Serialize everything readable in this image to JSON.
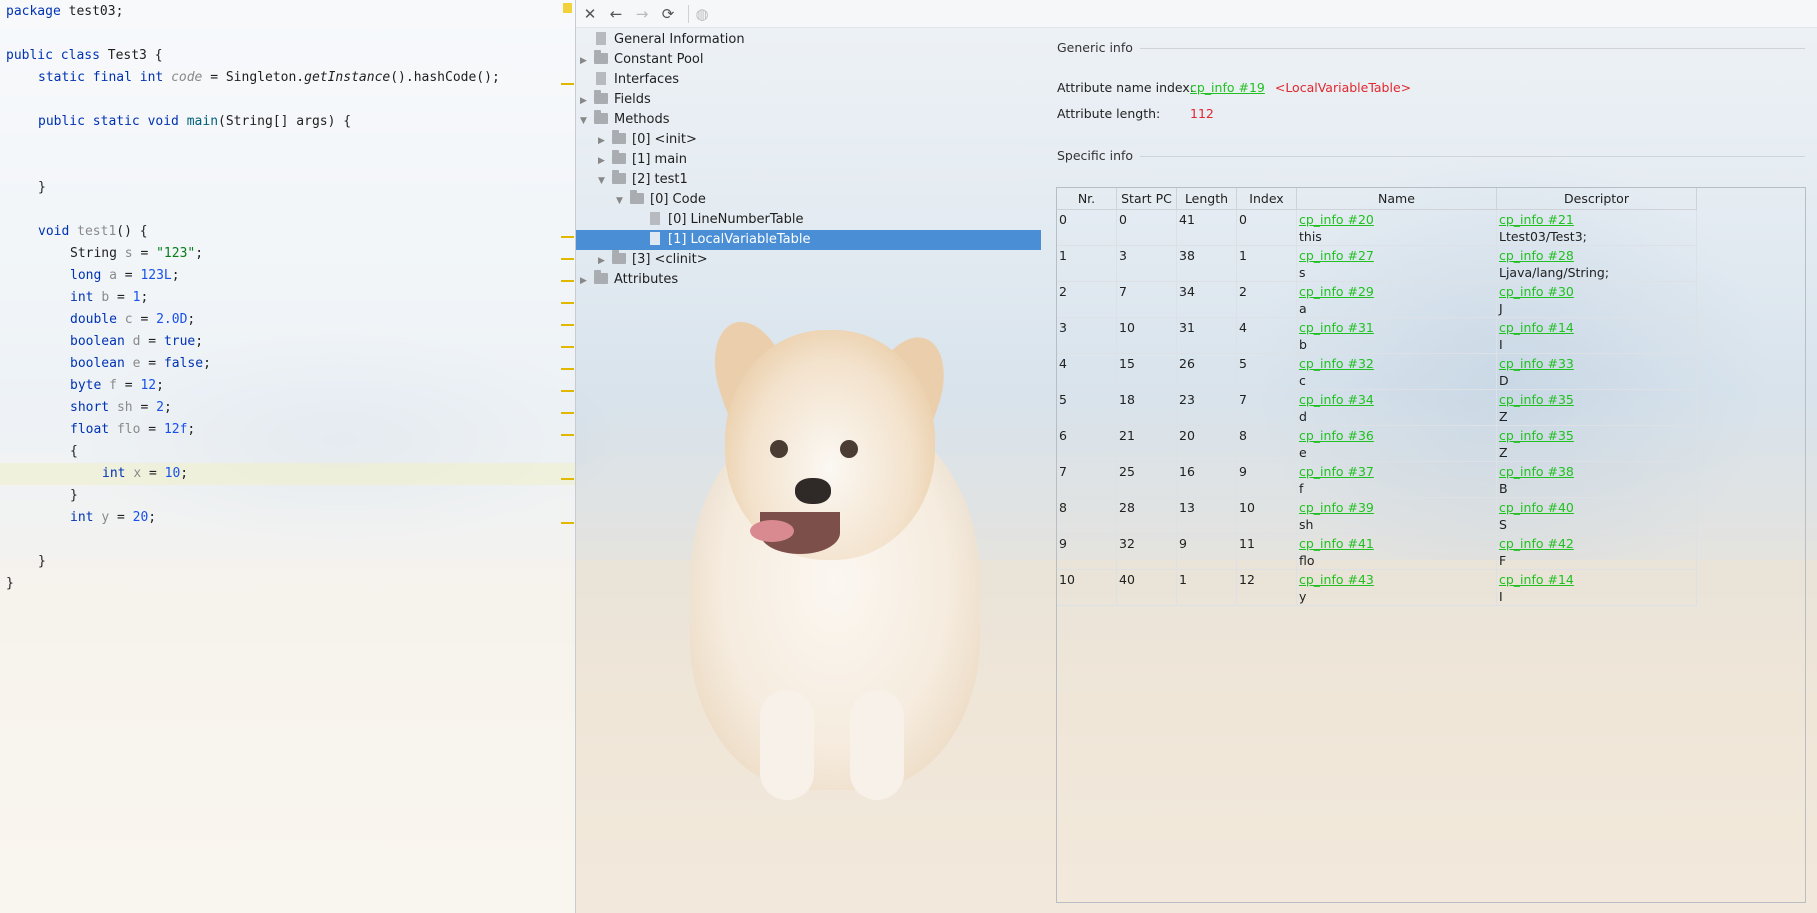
{
  "editor": {
    "lines": [
      {
        "n": 0,
        "text": "package test03;"
      },
      {
        "n": 1,
        "text": "public class Test3 {"
      },
      {
        "n": 2,
        "text": "static final int code = Singleton.getInstance().hashCode();"
      },
      {
        "n": 3,
        "text": "public static void main(String[] args) {"
      },
      {
        "n": 4,
        "text": "}"
      },
      {
        "n": 5,
        "text": "void test1() {"
      },
      {
        "n": 6,
        "text": "String s = \"123\";"
      },
      {
        "n": 7,
        "text": "long a = 123L;"
      },
      {
        "n": 8,
        "text": "int b = 1;"
      },
      {
        "n": 9,
        "text": "double c = 2.0D;"
      },
      {
        "n": 10,
        "text": "boolean d = true;"
      },
      {
        "n": 11,
        "text": "boolean e = false;"
      },
      {
        "n": 12,
        "text": "byte f = 12;"
      },
      {
        "n": 13,
        "text": "short sh = 2;"
      },
      {
        "n": 14,
        "text": "float flo = 12f;"
      },
      {
        "n": 15,
        "text": "{"
      },
      {
        "n": 16,
        "text": "int x = 10;"
      },
      {
        "n": 17,
        "text": "}"
      },
      {
        "n": 18,
        "text": "int y = 20;"
      },
      {
        "n": 19,
        "text": "}"
      },
      {
        "n": 20,
        "text": "}"
      }
    ]
  },
  "toolbar": {
    "close_icon": "close-icon",
    "back_icon": "arrow-left-icon",
    "forward_icon": "arrow-right-icon",
    "refresh_icon": "refresh-icon",
    "web_icon": "globe-icon"
  },
  "tree": {
    "general_information": "General Information",
    "constant_pool": "Constant Pool",
    "interfaces": "Interfaces",
    "fields": "Fields",
    "methods": "Methods",
    "method_0": "[0] <init>",
    "method_1": "[1] main",
    "method_2": "[2] test1",
    "code": "[0] Code",
    "line_number_table": "[0] LineNumberTable",
    "local_variable_table": "[1] LocalVariableTable",
    "method_3": "[3] <clinit>",
    "attributes": "Attributes"
  },
  "details": {
    "generic_info_title": "Generic info",
    "attr_name_index_label": "Attribute name index:",
    "attr_name_index_link": "cp_info #19",
    "attr_name_index_value": "<LocalVariableTable>",
    "attr_length_label": "Attribute length:",
    "attr_length_value": "112",
    "specific_info_title": "Specific info",
    "columns": [
      "Nr.",
      "Start PC",
      "Length",
      "Index",
      "Name",
      "Descriptor"
    ],
    "rows": [
      {
        "nr": "0",
        "start_pc": "0",
        "length": "41",
        "index": "0",
        "name_link": "cp_info #20",
        "name": "this",
        "desc_link": "cp_info #21",
        "desc": "Ltest03/Test3;"
      },
      {
        "nr": "1",
        "start_pc": "3",
        "length": "38",
        "index": "1",
        "name_link": "cp_info #27",
        "name": "s",
        "desc_link": "cp_info #28",
        "desc": "Ljava/lang/String;"
      },
      {
        "nr": "2",
        "start_pc": "7",
        "length": "34",
        "index": "2",
        "name_link": "cp_info #29",
        "name": "a",
        "desc_link": "cp_info #30",
        "desc": "J"
      },
      {
        "nr": "3",
        "start_pc": "10",
        "length": "31",
        "index": "4",
        "name_link": "cp_info #31",
        "name": "b",
        "desc_link": "cp_info #14",
        "desc": "I"
      },
      {
        "nr": "4",
        "start_pc": "15",
        "length": "26",
        "index": "5",
        "name_link": "cp_info #32",
        "name": "c",
        "desc_link": "cp_info #33",
        "desc": "D"
      },
      {
        "nr": "5",
        "start_pc": "18",
        "length": "23",
        "index": "7",
        "name_link": "cp_info #34",
        "name": "d",
        "desc_link": "cp_info #35",
        "desc": "Z"
      },
      {
        "nr": "6",
        "start_pc": "21",
        "length": "20",
        "index": "8",
        "name_link": "cp_info #36",
        "name": "e",
        "desc_link": "cp_info #35",
        "desc": "Z"
      },
      {
        "nr": "7",
        "start_pc": "25",
        "length": "16",
        "index": "9",
        "name_link": "cp_info #37",
        "name": "f",
        "desc_link": "cp_info #38",
        "desc": "B"
      },
      {
        "nr": "8",
        "start_pc": "28",
        "length": "13",
        "index": "10",
        "name_link": "cp_info #39",
        "name": "sh",
        "desc_link": "cp_info #40",
        "desc": "S"
      },
      {
        "nr": "9",
        "start_pc": "32",
        "length": "9",
        "index": "11",
        "name_link": "cp_info #41",
        "name": "flo",
        "desc_link": "cp_info #42",
        "desc": "F"
      },
      {
        "nr": "10",
        "start_pc": "40",
        "length": "1",
        "index": "12",
        "name_link": "cp_info #43",
        "name": "y",
        "desc_link": "cp_info #14",
        "desc": "I"
      }
    ]
  },
  "colors": {
    "link": "#22c022",
    "value_red": "#e0282e",
    "selection": "#4a8fd6",
    "keyword": "#0033b3",
    "number": "#1750eb",
    "string": "#067d17"
  }
}
